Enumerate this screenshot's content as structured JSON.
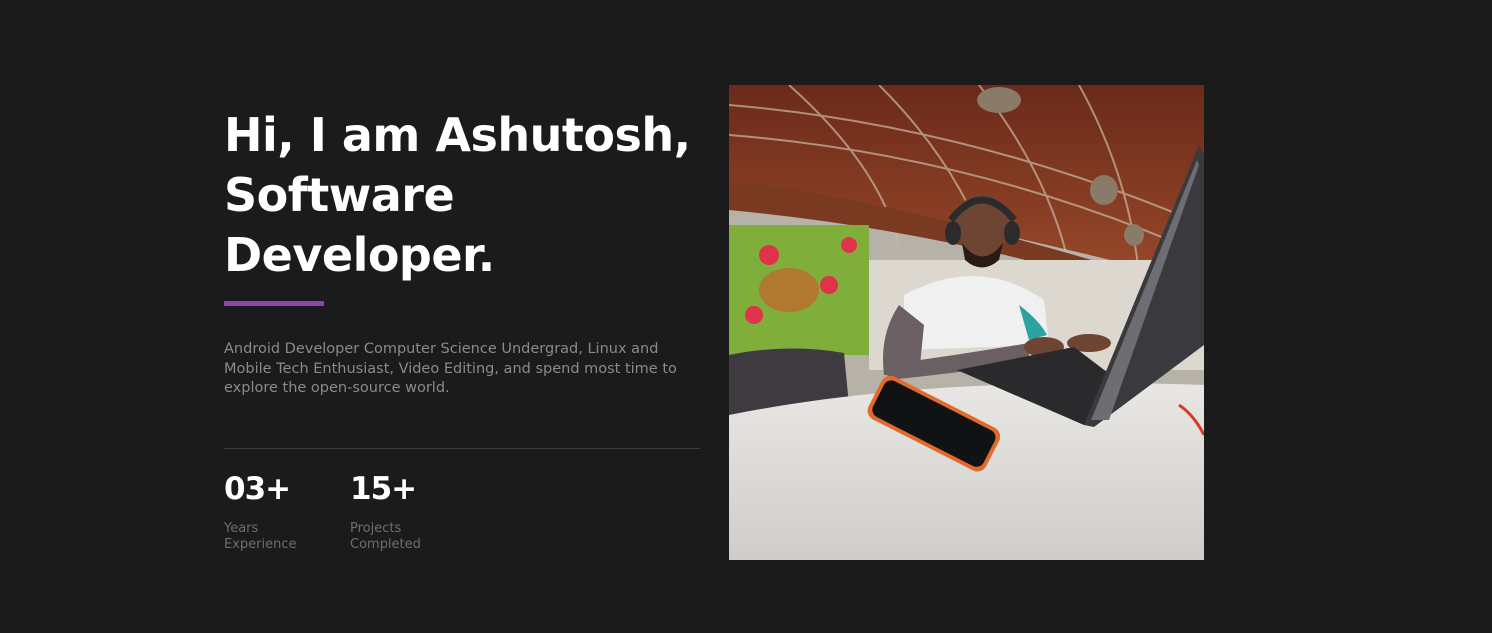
{
  "hero": {
    "headline_line1": "Hi, I am Ashutosh,",
    "headline_line2": "Software",
    "headline_line3": "Developer.",
    "accent_color": "#8e44ad",
    "bio": "Android Developer Computer Science Undergrad, Linux and Mobile Tech Enthusiast, Video Editing, and spend most time to explore the open-source world."
  },
  "stats": [
    {
      "value": "03+",
      "label_line1": "Years",
      "label_line2": "Experience"
    },
    {
      "value": "15+",
      "label_line1": "Projects",
      "label_line2": "Completed"
    }
  ],
  "colors": {
    "background": "#1b1b1b",
    "headline": "#ffffff",
    "muted_text": "#8a8a8a",
    "divider": "#3a3a3a"
  }
}
